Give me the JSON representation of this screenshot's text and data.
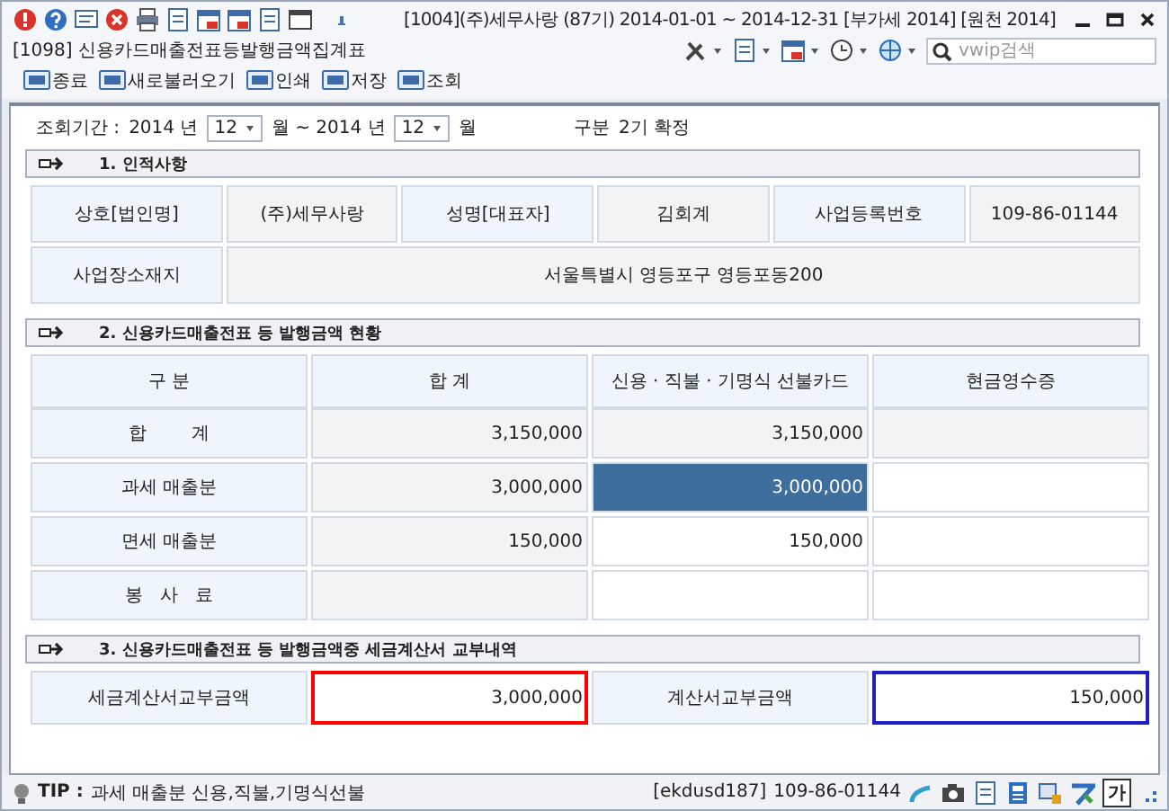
{
  "window": {
    "title": "[1004](주)세무사랑 (87기) 2014-01-01 ~ 2014-12-31 [부가세 2014] [원천 2014]",
    "form_title": "[1098] 신용카드매출전표등발행금액집계표"
  },
  "search": {
    "placeholder": "vwip검색"
  },
  "toolbar": [
    {
      "label": "종료"
    },
    {
      "label": "새로불러오기"
    },
    {
      "label": "인쇄"
    },
    {
      "label": "저장"
    },
    {
      "label": "조회"
    }
  ],
  "filter": [
    {
      "kind": "text",
      "text": "조회기간 :"
    },
    {
      "kind": "text",
      "text": "2014 년"
    },
    {
      "kind": "select",
      "value": "12"
    },
    {
      "kind": "text",
      "text": "월 ~ 2014 년"
    },
    {
      "kind": "select",
      "value": "12"
    },
    {
      "kind": "text",
      "text": "월"
    },
    {
      "kind": "gap"
    },
    {
      "kind": "text",
      "text": "구분"
    },
    {
      "kind": "text",
      "text": "2기 확정"
    }
  ],
  "section1": {
    "title": "1. 인적사항",
    "rows": [
      [
        {
          "label": "상호[법인명]",
          "value": "(주)세무사랑"
        },
        {
          "label": "성명[대표자]",
          "value": "김회계"
        },
        {
          "label": "사업등록번호",
          "value": "109-86-01144"
        }
      ],
      [
        {
          "label": "사업장소재지",
          "value": "서울특별시 영등포구 영등포동200"
        }
      ]
    ]
  },
  "section2": {
    "title": "2. 신용카드매출전표 등 발행금액 현황",
    "columns": [
      "구 분",
      "합 계",
      "신용 · 직불 · 기명식 선불카드",
      "현금영수증"
    ],
    "rows": [
      [
        {
          "kind": "label",
          "text": "합        계",
          "selected": false
        },
        {
          "kind": "value",
          "text": "3,150,000",
          "selected": false
        },
        {
          "kind": "value",
          "text": "3,150,000",
          "selected": false
        },
        {
          "kind": "value",
          "selected": false
        }
      ],
      [
        {
          "kind": "label",
          "text": "과세 매출분",
          "selected": false
        },
        {
          "kind": "value",
          "text": "3,000,000",
          "selected": false
        },
        {
          "kind": "input",
          "text": "3,000,000",
          "selected": true
        },
        {
          "kind": "input",
          "selected": false
        }
      ],
      [
        {
          "kind": "label",
          "text": "면세 매출분",
          "selected": false
        },
        {
          "kind": "value",
          "text": "150,000",
          "selected": false
        },
        {
          "kind": "input",
          "text": "150,000",
          "selected": false
        },
        {
          "kind": "input",
          "selected": false
        }
      ],
      [
        {
          "kind": "label",
          "text": "봉   사   료",
          "selected": false
        },
        {
          "kind": "value",
          "selected": false
        },
        {
          "kind": "input",
          "selected": false
        },
        {
          "kind": "input",
          "selected": false
        }
      ]
    ]
  },
  "section3": {
    "title": "3. 신용카드매출전표 등 발행금액중 세금계산서 교부내역",
    "cells": [
      {
        "kind": "label",
        "text": "세금계산서교부금액"
      },
      {
        "kind": "input",
        "text": "3,000,000",
        "color": "#ff0000"
      },
      {
        "kind": "label",
        "text": "계산서교부금액"
      },
      {
        "kind": "input",
        "text": "150,000",
        "color": "#2020c0"
      }
    ]
  },
  "status_bar": {
    "tip_label": "TIP :",
    "tip": "과세 매출분 신용,직불,기명식선불",
    "user": "[ekdusd187]",
    "biz_no": "109-86-01144",
    "ime": "가"
  }
}
